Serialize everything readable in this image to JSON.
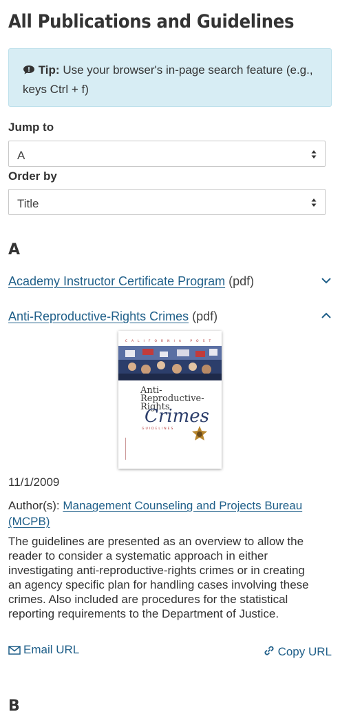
{
  "page": {
    "title": "All Publications and Guidelines"
  },
  "tip": {
    "icon": "comment-info-icon",
    "bold": "Tip:",
    "text": " Use your browser's in-page search feature (e.g., keys Ctrl + f)"
  },
  "jump_to": {
    "label": "Jump to",
    "value": "A"
  },
  "order_by": {
    "label": "Order by",
    "value": "Title"
  },
  "sections": [
    {
      "letter": "A",
      "items": [
        {
          "title": "Academy Instructor Certificate Program",
          "type": "(pdf)",
          "expanded": false
        },
        {
          "title": "Anti-Reproductive-Rights Crimes",
          "type": "(pdf)",
          "expanded": true,
          "cover": {
            "header": "CALIFORNIA POST",
            "title_line1": "Anti-",
            "title_line2": "Reproductive-",
            "title_line3": "Rights",
            "title_big": "Crimes",
            "subtitle": "GUIDELINES"
          },
          "date": "11/1/2009",
          "authors_label": "Author(s):",
          "author": "Management Counseling and Projects Bureau (MCPB)",
          "description": "The guidelines are presented as an overview to allow the reader to consider a systematic approach in either investigating anti-reproductive-rights crimes or in creating an agency specific plan for handling cases involving these crimes. Also included are procedures for the statistical reporting requirements to the Department of Justice.",
          "email_label": "Email URL",
          "copy_label": "Copy URL"
        }
      ]
    },
    {
      "letter": "B",
      "items": []
    }
  ],
  "colors": {
    "link": "#1f5f89",
    "tip_bg": "#d7edf4"
  }
}
